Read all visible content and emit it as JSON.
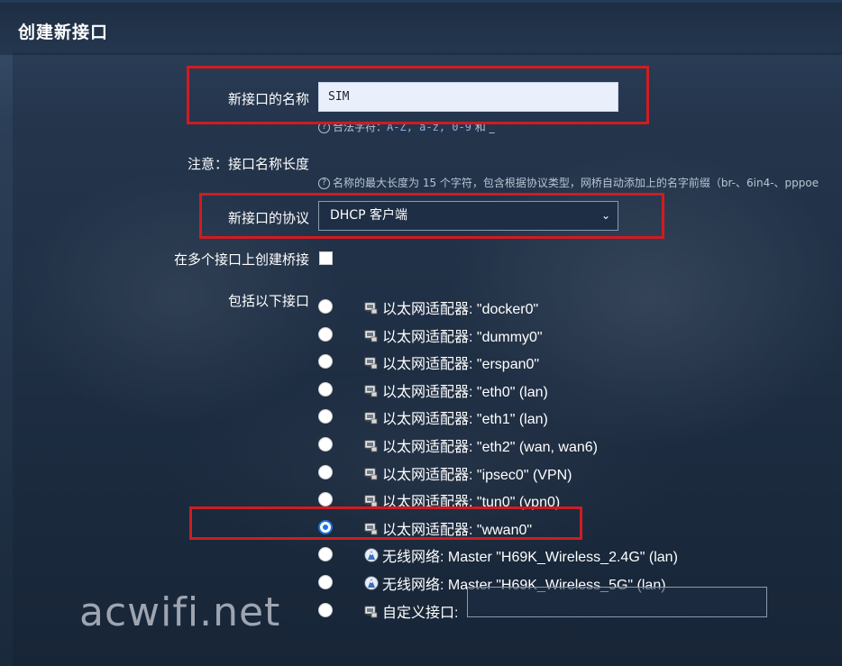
{
  "header": {
    "title": "创建新接口"
  },
  "form": {
    "name_label": "新接口的名称",
    "name_value": "SIM",
    "name_hint_prefix": "合法字符：",
    "name_hint_chars": "A-Z, a-z, 0-9",
    "name_hint_suffix": "和 _",
    "note_label": "注意：接口名称长度",
    "note_hint": "名称的最大长度为 15 个字符，包含根据协议类型，网桥自动添加上的名字前缀（br-、6in4-、pppoe",
    "protocol_label": "新接口的协议",
    "protocol_value": "DHCP 客户端",
    "bridge_label": "在多个接口上创建桥接",
    "include_label": "包括以下接口",
    "interfaces": [
      {
        "label": "以太网适配器: \"docker0\"",
        "icon": "ethernet-port-icon",
        "checked": false
      },
      {
        "label": "以太网适配器: \"dummy0\"",
        "icon": "ethernet-port-icon",
        "checked": false
      },
      {
        "label": "以太网适配器: \"erspan0\"",
        "icon": "ethernet-port-icon",
        "checked": false
      },
      {
        "label": "以太网适配器: \"eth0\" (lan)",
        "icon": "ethernet-port-icon",
        "checked": false
      },
      {
        "label": "以太网适配器: \"eth1\" (lan)",
        "icon": "ethernet-port-icon",
        "checked": false
      },
      {
        "label": "以太网适配器: \"eth2\" (wan, wan6)",
        "icon": "ethernet-port-icon",
        "checked": false
      },
      {
        "label": "以太网适配器: \"ipsec0\" (VPN)",
        "icon": "ethernet-port-icon",
        "checked": false
      },
      {
        "label": "以太网适配器: \"tun0\" (vpn0)",
        "icon": "ethernet-port-icon",
        "checked": false
      },
      {
        "label": "以太网适配器: \"wwan0\"",
        "icon": "ethernet-port-icon",
        "checked": true
      },
      {
        "label": "无线网络: Master \"H69K_Wireless_2.4G\" (lan)",
        "icon": "wireless-icon",
        "checked": false
      },
      {
        "label": "无线网络: Master \"H69K_Wireless_5G\" (lan)",
        "icon": "wireless-icon",
        "checked": false
      },
      {
        "label": "自定义接口:",
        "icon": "ethernet-port-icon",
        "checked": false
      }
    ]
  },
  "watermark": "acwifi.net",
  "colors": {
    "highlight": "#d01c22",
    "radio_accent": "#1e74e0"
  }
}
